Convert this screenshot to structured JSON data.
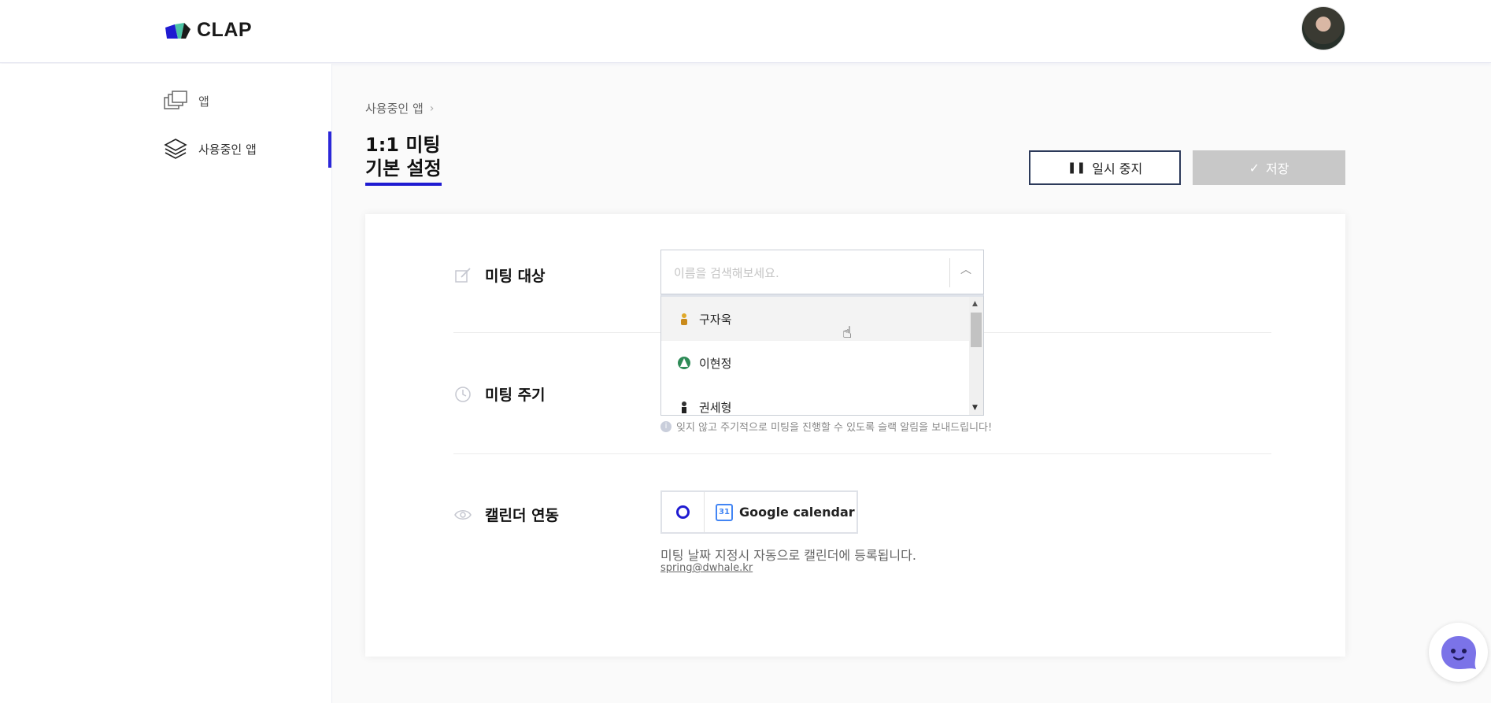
{
  "brand": {
    "name": "CLAP"
  },
  "sidebar": {
    "items": [
      {
        "label": "앱",
        "icon": "windows-stack-icon"
      },
      {
        "label": "사용중인 앱",
        "icon": "layers-icon"
      }
    ]
  },
  "breadcrumb": {
    "item": "사용중인 앱"
  },
  "page": {
    "title": "1:1 미팅",
    "subtitle": "기본 설정"
  },
  "actions": {
    "pause_label": "일시 중지",
    "save_label": "저장"
  },
  "form": {
    "target": {
      "label": "미팅 대상",
      "placeholder": "이름을 검색해보세요.",
      "options": [
        {
          "name": "구자욱",
          "icon": "person-gold-icon"
        },
        {
          "name": "이현정",
          "icon": "person-green-icon"
        },
        {
          "name": "권세형",
          "icon": "person-dark-icon"
        }
      ]
    },
    "cycle": {
      "label": "미팅 주기",
      "hint": "잊지 않고 주기적으로 미팅을 진행할 수 있도록 슬랙 알림을 보내드립니다!"
    },
    "calendar": {
      "label": "캘린더 연동",
      "provider": "Google calendar",
      "note": "미팅 날짜 지정시 자동으로 캘린더에 등록됩니다.",
      "email": "spring@dwhale.kr"
    }
  },
  "colors": {
    "accent": "#1f1bd1",
    "save_disabled": "#c8c8c8"
  }
}
